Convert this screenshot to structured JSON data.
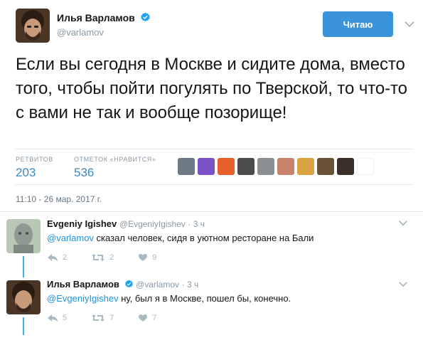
{
  "tweet": {
    "author": {
      "name": "Илья Варламов",
      "handle": "@varlamov"
    },
    "follow_button": "Читаю",
    "text": "Если вы сегодня в Москве и сидите дома, вместо того, чтобы пойти погулять по Тверской, то что-то с вами не так и вообще позорище!",
    "stats": {
      "retweets_label": "РЕТВИТОВ",
      "retweets": "203",
      "likes_label": "ОТМЕТОК «НРАВИТСЯ»",
      "likes": "536"
    },
    "timestamp": "11:10 - 26 мар. 2017 г."
  },
  "replies": [
    {
      "name": "Evgeniy Igishev",
      "handle": "@EvgeniyIgishev",
      "time": "· 3 ч",
      "mention": "@varlamov",
      "text": " сказал человек, сидя в уютном ресторане на Бали",
      "reply_count": "2",
      "retweet_count": "2",
      "like_count": "9"
    },
    {
      "name": "Илья Варламов",
      "handle": "@varlamov",
      "time": "· 3 ч",
      "mention": "@EvgeniyIgishev",
      "text": " ну, был я в Москве, пошел бы, конечно.",
      "reply_count": "5",
      "retweet_count": "7",
      "like_count": "7"
    }
  ],
  "colors": {
    "accent": "#1da1f2",
    "button": "#3b94d9",
    "muted": "#8899a6",
    "icon": "#aab8c2"
  },
  "icons": {
    "verified": "verified-badge-icon",
    "chevron": "chevron-down-icon",
    "reply": "reply-icon",
    "retweet": "retweet-icon",
    "like": "heart-icon"
  }
}
